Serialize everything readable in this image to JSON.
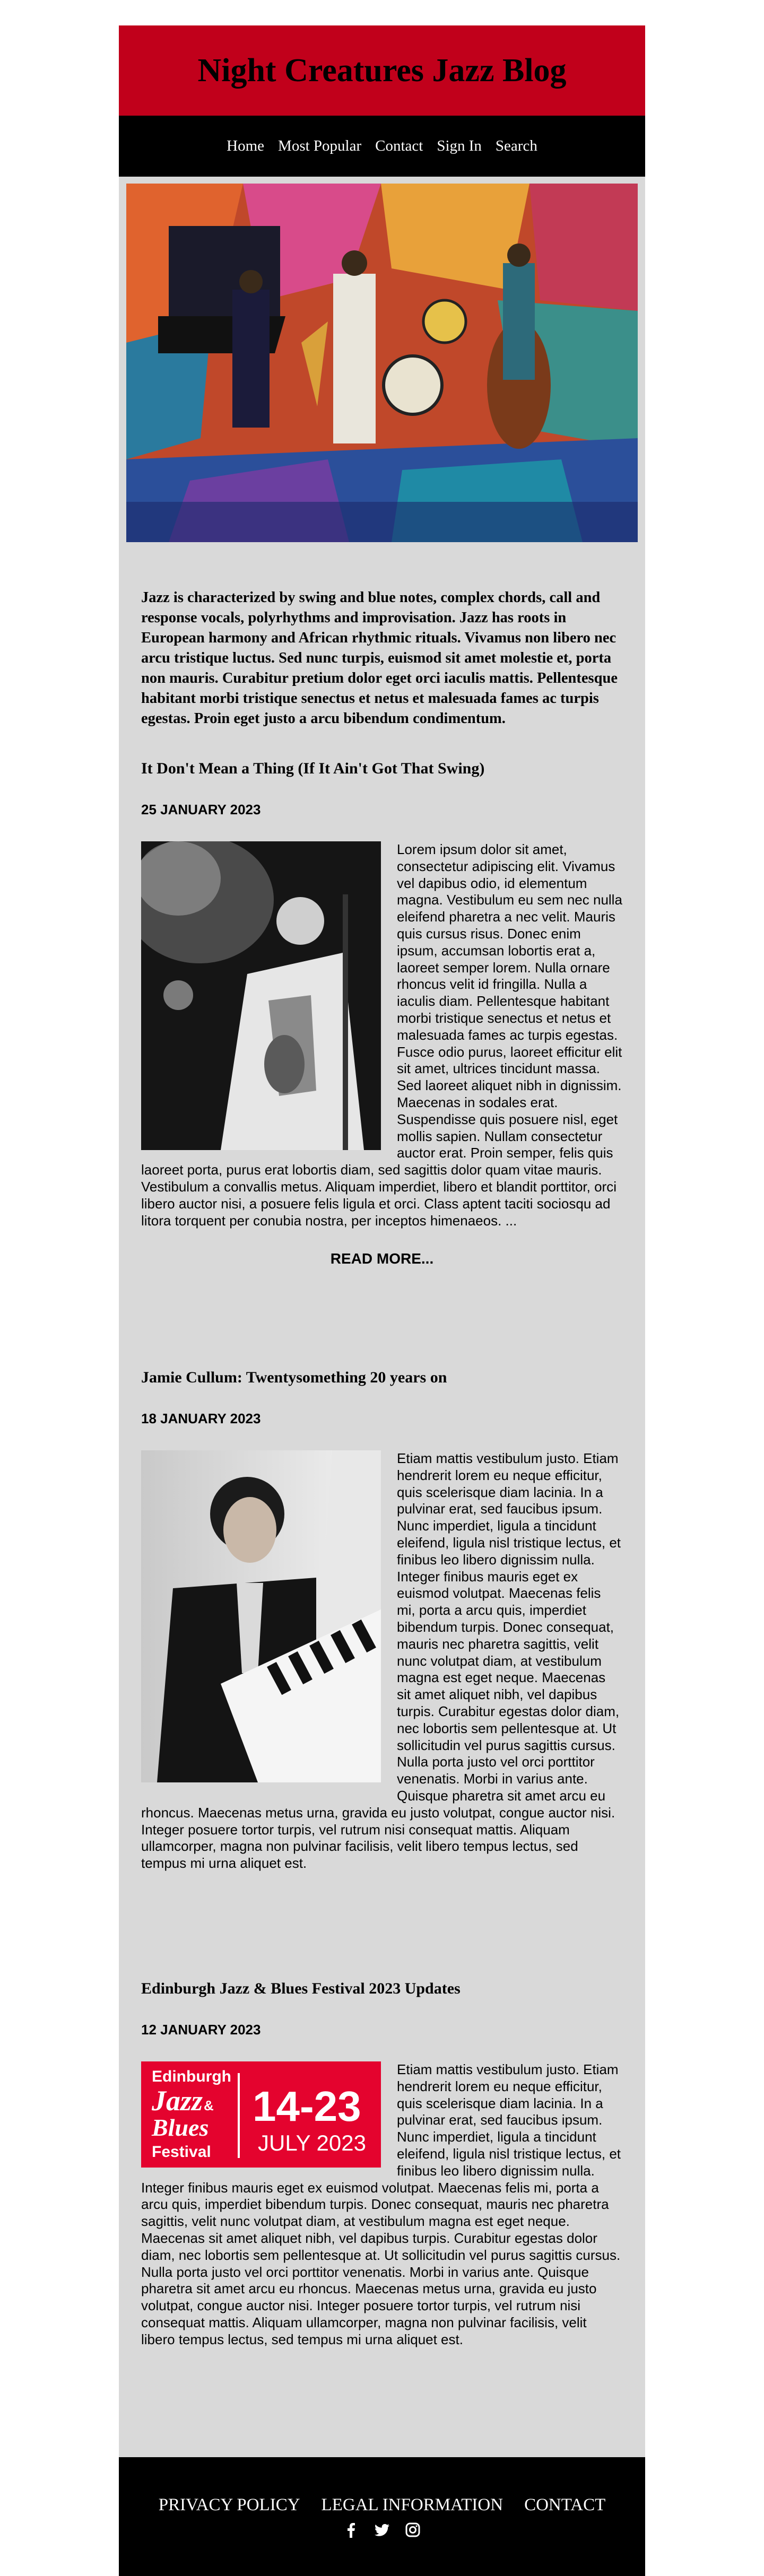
{
  "site": {
    "title": "Night Creatures Jazz Blog"
  },
  "nav": {
    "items": [
      "Home",
      "Most Popular",
      "Contact",
      "Sign In",
      "Search"
    ]
  },
  "intro": "Jazz is characterized by swing and blue notes, complex chords, call and response vocals, polyrhythms and improvisation. Jazz has roots in European harmony and African rhythmic rituals. Vivamus non libero nec arcu tristique luctus. Sed nunc turpis, euismod sit amet molestie et, porta non mauris. Curabitur pretium dolor eget orci iaculis mattis. Pellentesque habitant morbi tristique senectus et netus et malesuada fames ac turpis egestas. Proin eget justo a arcu bibendum condimentum.",
  "posts": [
    {
      "title": "It Don't Mean a Thing (If It Ain't Got That Swing)",
      "date": "25 JANUARY 2023",
      "body": "Lorem ipsum dolor sit amet, consectetur adipiscing elit. Vivamus vel dapibus odio, id elementum magna. Vestibulum eu sem nec nulla eleifend pharetra a nec velit. Mauris quis cursus risus. Donec enim ipsum, accumsan lobortis erat a, laoreet semper lorem. Nulla ornare rhoncus velit id fringilla. Nulla a iaculis diam. Pellentesque habitant morbi tristique senectus et netus et malesuada fames ac turpis egestas. Fusce odio purus, laoreet efficitur elit sit amet, ultrices tincidunt massa. Sed laoreet aliquet nibh in dignissim. Maecenas in sodales erat. Suspendisse quis posuere nisl, eget mollis sapien. Nullam consectetur auctor erat. Proin semper, felis quis laoreet porta, purus erat lobortis diam, sed sagittis dolor quam vitae mauris. Vestibulum a convallis metus. Aliquam imperdiet, libero et blandit porttitor, orci libero auctor nisi, a posuere felis ligula et orci. Class aptent taciti sociosqu ad litora torquent per conubia nostra, per inceptos himenaeos. ...",
      "read_more": "READ MORE..."
    },
    {
      "title": "Jamie Cullum: Twentysomething 20 years on",
      "date": "18 JANUARY 2023",
      "body": "Etiam mattis vestibulum justo. Etiam hendrerit lorem eu neque efficitur, quis scelerisque diam lacinia. In a pulvinar erat, sed faucibus ipsum. Nunc imperdiet, ligula a tincidunt eleifend, ligula nisl tristique lectus, et finibus leo libero dignissim nulla. Integer finibus mauris eget ex euismod volutpat. Maecenas felis mi, porta a arcu quis, imperdiet bibendum turpis. Donec consequat, mauris nec pharetra sagittis, velit nunc volutpat diam, at vestibulum magna est eget neque. Maecenas sit amet aliquet nibh, vel dapibus turpis. Curabitur egestas dolor diam, nec lobortis sem pellentesque at. Ut sollicitudin vel purus sagittis cursus. Nulla porta justo vel orci porttitor venenatis. Morbi in varius ante. Quisque pharetra sit amet arcu eu rhoncus. Maecenas metus urna, gravida eu justo volutpat, congue auctor nisi. Integer posuere tortor turpis, vel rutrum nisi consequat mattis. Aliquam ullamcorper, magna non pulvinar facilisis, velit libero tempus lectus, sed tempus mi urna aliquet est."
    },
    {
      "title": "Edinburgh Jazz & Blues Festival 2023 Updates",
      "date": "12 JANUARY 2023",
      "body": "Etiam mattis vestibulum justo. Etiam hendrerit lorem eu neque efficitur, quis scelerisque diam lacinia. In a pulvinar erat, sed faucibus ipsum. Nunc imperdiet, ligula a tincidunt eleifend, ligula nisl tristique lectus, et finibus leo libero dignissim nulla. Integer finibus mauris eget ex euismod volutpat. Maecenas felis mi, porta a arcu quis, imperdiet bibendum turpis. Donec consequat, mauris nec pharetra sagittis, velit nunc volutpat diam, at vestibulum magna est eget neque. Maecenas sit amet aliquet nibh, vel dapibus turpis. Curabitur egestas dolor diam, nec lobortis sem pellentesque at. Ut sollicitudin vel purus sagittis cursus. Nulla porta justo vel orci porttitor venenatis. Morbi in varius ante. Quisque pharetra sit amet arcu eu rhoncus. Maecenas metus urna, gravida eu justo volutpat, congue auctor nisi. Integer posuere tortor turpis, vel rutrum nisi consequat mattis. Aliquam ullamcorper, magna non pulvinar facilisis, velit libero tempus lectus, sed tempus mi urna aliquet est.",
      "poster": {
        "line1": "Edinburgh",
        "line2": "Jazz",
        "line3": "&",
        "line4": "Blues",
        "line5": "Festival",
        "dates": "14-23",
        "month": "JULY 2023"
      }
    }
  ],
  "footer": {
    "links": [
      "PRIVACY POLICY",
      "LEGAL INFORMATION",
      "CONTACT"
    ],
    "social": [
      "facebook-icon",
      "twitter-icon",
      "instagram-icon"
    ]
  },
  "colors": {
    "brand_red": "#c1001b",
    "page_bg": "#d9d9d9",
    "nav_bg": "#000000"
  }
}
